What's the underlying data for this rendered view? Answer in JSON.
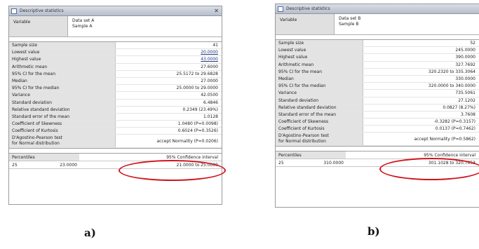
{
  "panel_a": {
    "title": "Descriptive statistics",
    "variable_label": "Variable",
    "variable_values": [
      "Data set A",
      "Sample A"
    ],
    "stats": [
      {
        "label": "Sample size",
        "value": "41"
      },
      {
        "label": "Lowest value",
        "value": "20.0000",
        "link": true
      },
      {
        "label": "Highest value",
        "value": "43.0000",
        "link": true
      },
      {
        "label": "Arithmetic mean",
        "value": "27.6000"
      },
      {
        "label": "95% CI for the mean",
        "value": "25.5172 to 29.6828"
      },
      {
        "label": "Median",
        "value": "27.0000"
      },
      {
        "label": "95% CI for the median",
        "value": "25.0000 to 29.0000"
      },
      {
        "label": "Variance",
        "value": "42.0500"
      },
      {
        "label": "Standard deviation",
        "value": "6.4846"
      },
      {
        "label": "Relative standard deviation",
        "value": "0.2349 (23.49%)"
      },
      {
        "label": "Standard error of the mean",
        "value": "1.0128"
      },
      {
        "label": "Coefficient of Skewness",
        "value": "1.0480 (P=0.0098)"
      },
      {
        "label": "Coefficient of Kurtosis",
        "value": "0.6024 (P=0.3526)"
      },
      {
        "label": "D'Agostino-Pearson test",
        "label2": "for Normal distribution",
        "value": "accept Normality (P=0.0206)",
        "tall": true
      }
    ],
    "percentile": {
      "header_left": "Percentiles",
      "header_right": "95% Confidence interval",
      "p": "25",
      "value": "23.0000",
      "ci": "21.0000 to 25.0000"
    }
  },
  "panel_b": {
    "title": "Descriptive statistics",
    "variable_label": "Variable",
    "variable_values": [
      "Data set B",
      "Sample B"
    ],
    "stats": [
      {
        "label": "Sample size",
        "value": "52"
      },
      {
        "label": "Lowest value",
        "value": "245.0000"
      },
      {
        "label": "Highest value",
        "value": "390.0000"
      },
      {
        "label": "Arithmetic mean",
        "value": "327.7692"
      },
      {
        "label": "95% CI for the mean",
        "value": "320.2320 to 335.3064"
      },
      {
        "label": "Median",
        "value": "330.0000"
      },
      {
        "label": "95% CI for the median",
        "value": "320.0000 to 340.0000"
      },
      {
        "label": "Variance",
        "value": "735.5061"
      },
      {
        "label": "Standard deviation",
        "value": "27.1202"
      },
      {
        "label": "Relative standard deviation",
        "value": "0.0827 (8.27%)"
      },
      {
        "label": "Standard error of the mean",
        "value": "3.7608"
      },
      {
        "label": "Coefficient of Skewness",
        "value": "-0.3282 (P=0.3157)"
      },
      {
        "label": "Coefficient of Kurtosis",
        "value": "0.0137 (P=0.7462)"
      },
      {
        "label": "D'Agostino-Pearson test",
        "label2": "for Normal distribution",
        "value": "accept Normality (P=0.5862)",
        "tall": true
      }
    ],
    "percentile": {
      "header_left": "Percentiles",
      "header_right": "95% Confidence interval",
      "p": "25",
      "value": "310.0000",
      "ci": "301.1028 to 320.7653"
    }
  },
  "captions": {
    "a": "a)",
    "b": "b)"
  }
}
